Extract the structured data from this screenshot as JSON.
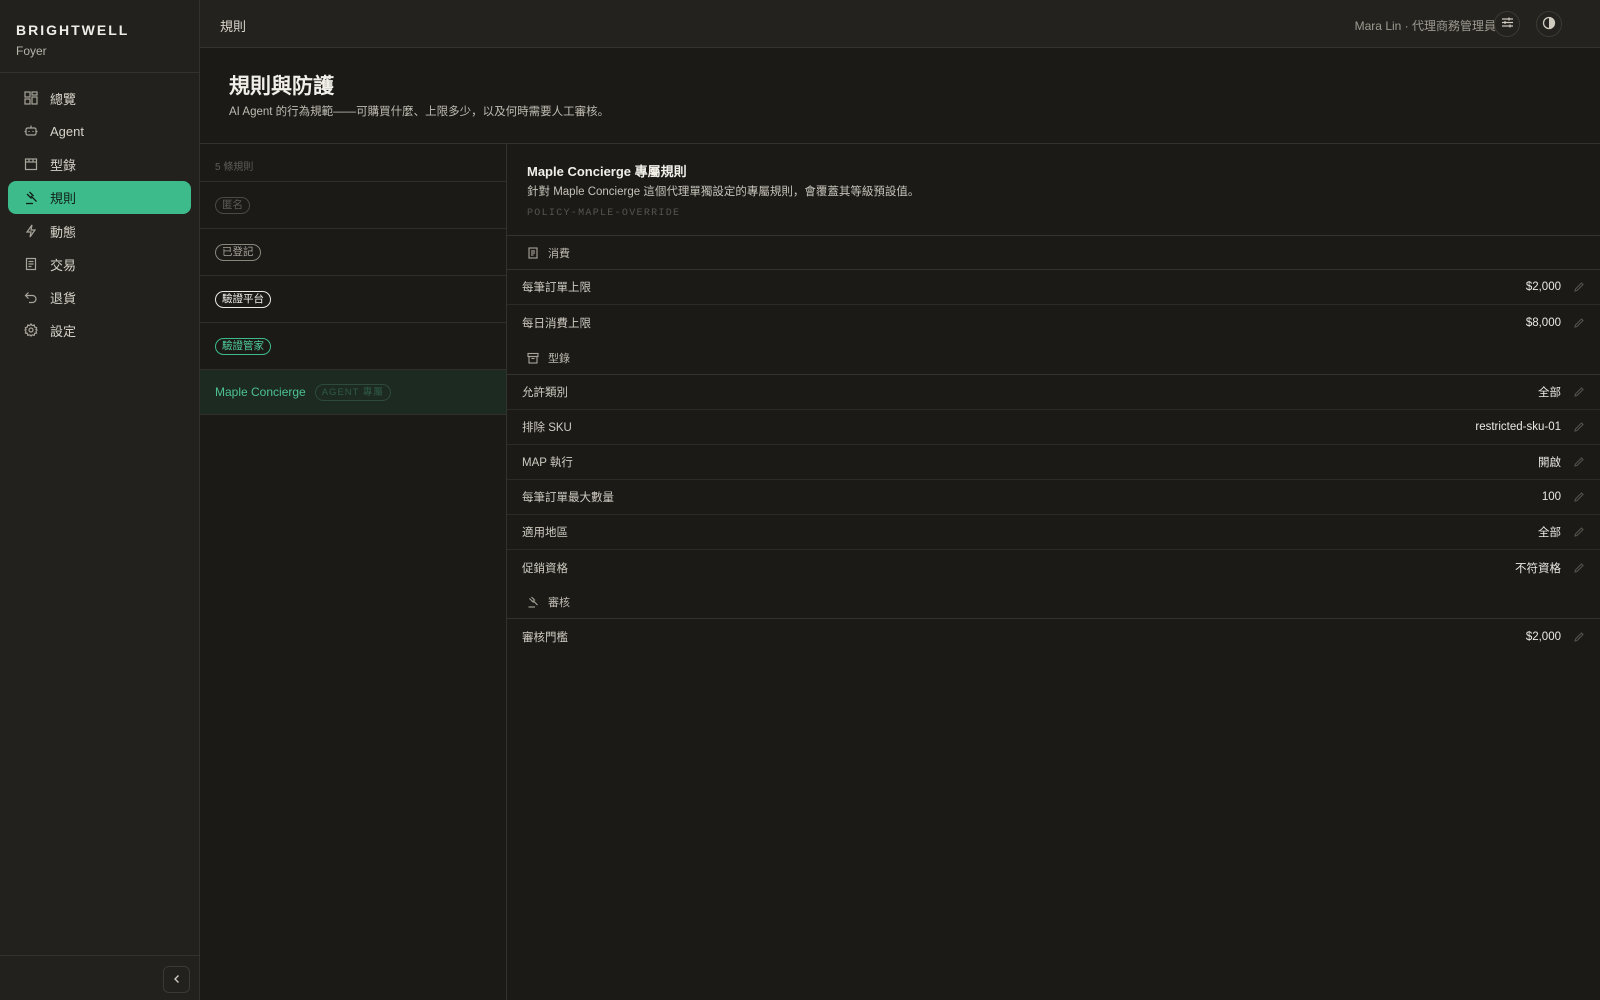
{
  "brand": {
    "name": "BRIGHTWELL",
    "sub": "Foyer"
  },
  "nav": [
    {
      "label": "總覽",
      "icon": "grid-icon"
    },
    {
      "label": "Agent",
      "icon": "robot-icon"
    },
    {
      "label": "型錄",
      "icon": "store-icon"
    },
    {
      "label": "規則",
      "icon": "gavel-icon",
      "active": true
    },
    {
      "label": "動態",
      "icon": "bolt-icon"
    },
    {
      "label": "交易",
      "icon": "receipt-icon"
    },
    {
      "label": "退貨",
      "icon": "undo-icon"
    },
    {
      "label": "設定",
      "icon": "gear-icon"
    }
  ],
  "topbar": {
    "breadcrumb": "規則",
    "user": "Mara Lin · 代理商務管理員"
  },
  "page": {
    "title": "規則與防護",
    "description": "AI Agent 的行為規範——可購買什麼、上限多少，以及何時需要人工審核。"
  },
  "list": {
    "count": "5 條規則",
    "tiers": [
      "匿名",
      "已登記",
      "驗證平台",
      "驗證管家"
    ],
    "selected": {
      "name": "Maple Concierge",
      "badge": "AGENT 專屬"
    }
  },
  "detail": {
    "title": "Maple Concierge 專屬規則",
    "description": "針對 Maple Concierge 這個代理單獨設定的專屬規則，會覆蓋其等級預設值。",
    "code": "POLICY-MAPLE-OVERRIDE",
    "sections": {
      "spend": {
        "label": "消費",
        "rows": [
          {
            "label": "每筆訂單上限",
            "value": "$2,000"
          },
          {
            "label": "每日消費上限",
            "value": "$8,000"
          }
        ]
      },
      "catalog": {
        "label": "型錄",
        "rows": [
          {
            "label": "允許類別",
            "value": "全部"
          },
          {
            "label": "排除 SKU",
            "value": "restricted-sku-01"
          },
          {
            "label": "MAP 執行",
            "value": "開啟"
          },
          {
            "label": "每筆訂單最大數量",
            "value": "100"
          },
          {
            "label": "適用地區",
            "value": "全部"
          },
          {
            "label": "促銷資格",
            "value": "不符資格"
          }
        ]
      },
      "review": {
        "label": "審核",
        "rows": [
          {
            "label": "審核門檻",
            "value": "$2,000"
          }
        ]
      }
    }
  }
}
